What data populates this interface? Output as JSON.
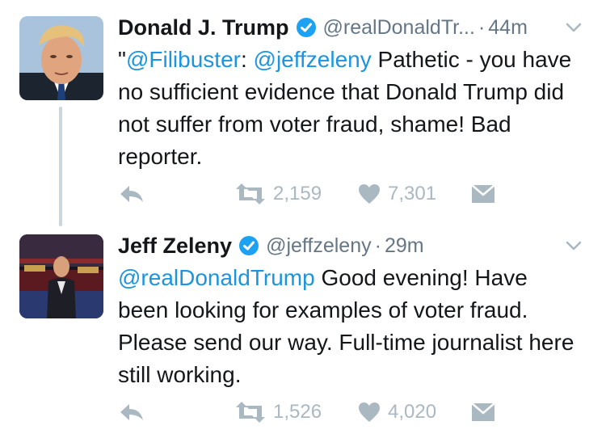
{
  "tweets": [
    {
      "author_name": "Donald J. Trump",
      "handle": "@realDonaldTr...",
      "separator": "·",
      "time": "44m",
      "text_parts": [
        {
          "text": "\"",
          "type": "plain"
        },
        {
          "text": "@Filibuster",
          "type": "mention"
        },
        {
          "text": ": ",
          "type": "plain"
        },
        {
          "text": "@jeffzeleny",
          "type": "mention"
        },
        {
          "text": " Pathetic - you have no sufficient evidence that Donald Trump did not suffer from voter fraud, shame! Bad reporter.",
          "type": "plain"
        }
      ],
      "retweets": "2,159",
      "likes": "7,301"
    },
    {
      "author_name": "Jeff Zeleny",
      "handle": "@jeffzeleny",
      "separator": "·",
      "time": "29m",
      "text_parts": [
        {
          "text": "@realDonaldTrump",
          "type": "mention"
        },
        {
          "text": " Good evening! Have been looking for examples of voter fraud. Please send our way. Full-time journalist here still working.",
          "type": "plain"
        }
      ],
      "retweets": "1,526",
      "likes": "4,020"
    }
  ],
  "icons": {
    "verified": "verified-badge-icon",
    "caret": "chevron-down-icon",
    "reply": "reply-icon",
    "retweet": "retweet-icon",
    "like": "heart-icon",
    "dm": "envelope-icon"
  },
  "colors": {
    "text": "#14171a",
    "secondary": "#657786",
    "mention": "#1b95e0",
    "verified": "#1da1f2",
    "action": "#aab8c2",
    "thread_line": "#ccd6dd"
  }
}
